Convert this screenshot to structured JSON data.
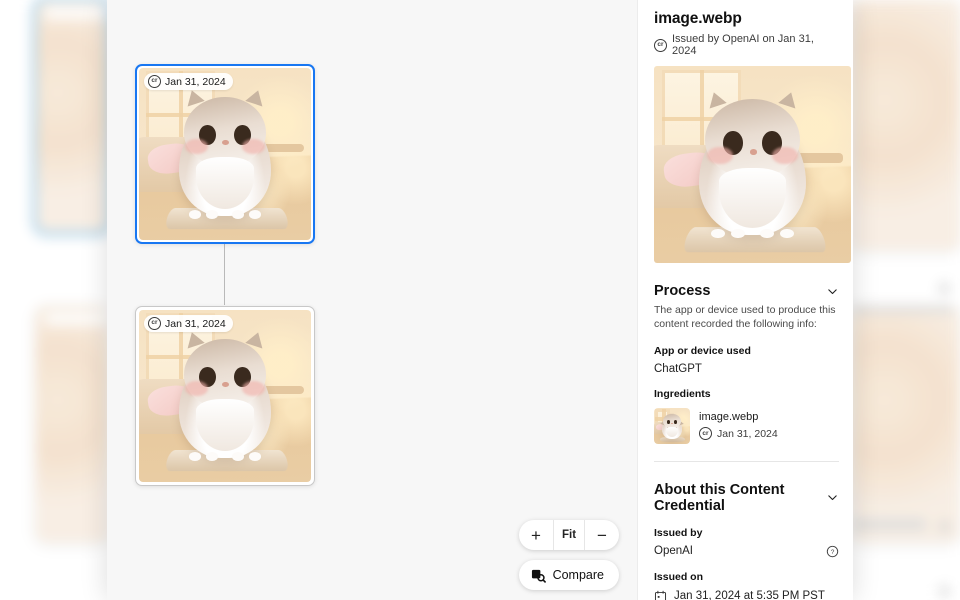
{
  "app": {
    "canvas_bg": "#f7f7f7",
    "accent": "#1877f2"
  },
  "canvas": {
    "nodes": [
      {
        "date_label": "Jan 31, 2024",
        "badge": "cr",
        "selected": true
      },
      {
        "date_label": "Jan 31, 2024",
        "badge": "cr",
        "selected": false
      }
    ],
    "controls": {
      "zoom_in_label": "+",
      "fit_label": "Fit",
      "zoom_out_label": "−",
      "compare_label": "Compare",
      "compare_icon": "compare-image-icon"
    }
  },
  "panel": {
    "title": "image.webp",
    "issued_line": "Issued by OpenAI on Jan 31, 2024",
    "issued_badge": "cr",
    "hero_alt": "fluffy-cat-image",
    "process": {
      "heading": "Process",
      "chevron": "chevron-down-icon",
      "description": "The app or device used to produce this content recorded the following info:",
      "app_label": "App or device used",
      "app_value": "ChatGPT",
      "ingredients_label": "Ingredients",
      "ingredients": [
        {
          "name": "image.webp",
          "date": "Jan 31, 2024",
          "badge": "cr"
        }
      ]
    },
    "about": {
      "heading": "About this Content Credential",
      "chevron": "chevron-down-icon",
      "issued_by_label": "Issued by",
      "issued_by_value": "OpenAI",
      "issued_by_info_icon": "help-circle-icon",
      "issued_on_label": "Issued on",
      "issued_on_value": "Jan 31, 2024 at 5:35 PM PST",
      "issued_on_icon": "calendar-icon"
    }
  }
}
